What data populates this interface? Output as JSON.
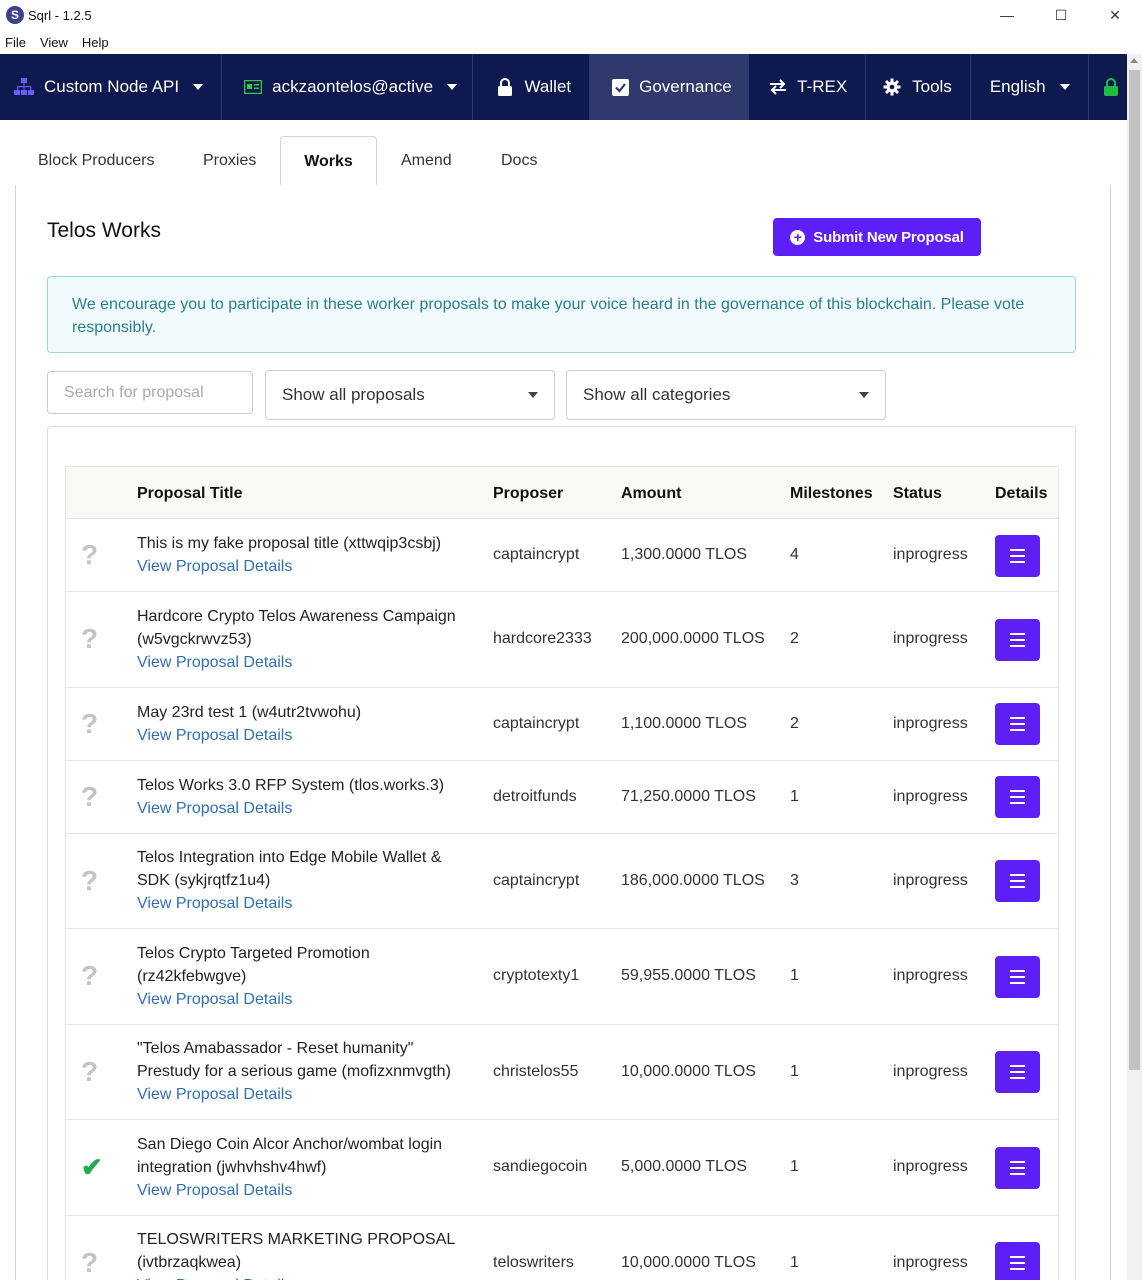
{
  "window": {
    "title": "Sqrl - 1.2.5",
    "logo_letter": "S",
    "controls": [
      "—",
      "☐",
      "✕"
    ]
  },
  "menu": [
    "File",
    "View",
    "Help"
  ],
  "nav": {
    "items": [
      {
        "label": "Custom Node API",
        "icon": "sitemap-icon",
        "caret": true
      },
      {
        "label": "ackzaontelos@active",
        "icon": "id-card-icon",
        "caret": true
      },
      {
        "label": "Wallet",
        "icon": "lock-icon",
        "caret": false
      },
      {
        "label": "Governance",
        "icon": "check-square-icon",
        "caret": false,
        "active": true
      },
      {
        "label": "T-REX",
        "icon": "exchange-icon",
        "caret": false
      },
      {
        "label": "Tools",
        "icon": "gear-icon",
        "caret": false
      },
      {
        "label": "English",
        "icon": "",
        "caret": true
      }
    ],
    "colors": {
      "bar": "#0e1a4f",
      "active": "#30396b",
      "lock_green": "#21ba45"
    }
  },
  "tabs": [
    "Block Producers",
    "Proxies",
    "Works",
    "Amend",
    "Docs"
  ],
  "active_tab": "Works",
  "page": {
    "title": "Telos Works",
    "submit_label": "Submit New Proposal",
    "info_text": "We encourage you to participate in these worker proposals to make your voice heard in the governance of this blockchain. Please vote responsibly."
  },
  "filters": {
    "search_placeholder": "Search for proposal",
    "proposal_filter": "Show all proposals",
    "category_filter": "Show all categories"
  },
  "table": {
    "headers": [
      "Proposal Title",
      "Proposer",
      "Amount",
      "Milestones",
      "Status",
      "Details"
    ],
    "link_label": "View Proposal Details",
    "rows": [
      {
        "vote": "question",
        "title_lines": [
          "This is my fake proposal title (xttwqip3csbj)"
        ],
        "proposer": "captaincrypt",
        "amount": "1,300.0000 TLOS",
        "milestones": "4",
        "status": "inprogress"
      },
      {
        "vote": "question",
        "title_lines": [
          "Hardcore Crypto Telos Awareness Campaign",
          "(w5vgckrwvz53)"
        ],
        "proposer": "hardcore2333",
        "amount": "200,000.0000 TLOS",
        "milestones": "2",
        "status": "inprogress"
      },
      {
        "vote": "question",
        "title_lines": [
          "May 23rd test 1 (w4utr2tvwohu)"
        ],
        "proposer": "captaincrypt",
        "amount": "1,100.0000 TLOS",
        "milestones": "2",
        "status": "inprogress"
      },
      {
        "vote": "question",
        "title_lines": [
          "Telos Works 3.0 RFP System (tlos.works.3)"
        ],
        "proposer": "detroitfunds",
        "amount": "71,250.0000 TLOS",
        "milestones": "1",
        "status": "inprogress"
      },
      {
        "vote": "question",
        "title_lines": [
          "Telos Integration into Edge Mobile Wallet &",
          "SDK (sykjrqtfz1u4)"
        ],
        "proposer": "captaincrypt",
        "amount": "186,000.0000 TLOS",
        "milestones": "3",
        "status": "inprogress"
      },
      {
        "vote": "question",
        "title_lines": [
          "Telos Crypto Targeted Promotion",
          "(rz42kfebwgve)"
        ],
        "proposer": "cryptotexty1",
        "amount": "59,955.0000 TLOS",
        "milestones": "1",
        "status": "inprogress"
      },
      {
        "vote": "question",
        "title_lines": [
          "\"Telos Amabassador - Reset humanity\"",
          "Prestudy for a serious game (mofizxnmvgth)"
        ],
        "proposer": "christelos55",
        "amount": "10,000.0000 TLOS",
        "milestones": "1",
        "status": "inprogress"
      },
      {
        "vote": "check",
        "title_lines": [
          "San Diego Coin Alcor Anchor/wombat login",
          "integration (jwhvhshv4hwf)"
        ],
        "proposer": "sandiegocoin",
        "amount": "5,000.0000 TLOS",
        "milestones": "1",
        "status": "inprogress"
      },
      {
        "vote": "question",
        "title_lines": [
          "TELOSWRITERS MARKETING PROPOSAL",
          "(ivtbrzaqkwea)"
        ],
        "proposer": "teloswriters",
        "amount": "10,000.0000 TLOS",
        "milestones": "1",
        "status": "inprogress"
      }
    ]
  },
  "colors": {
    "accent": "#5d1ff5",
    "link": "#2f6fb4",
    "info_text": "#2a7d94",
    "check": "#1fad4f"
  }
}
